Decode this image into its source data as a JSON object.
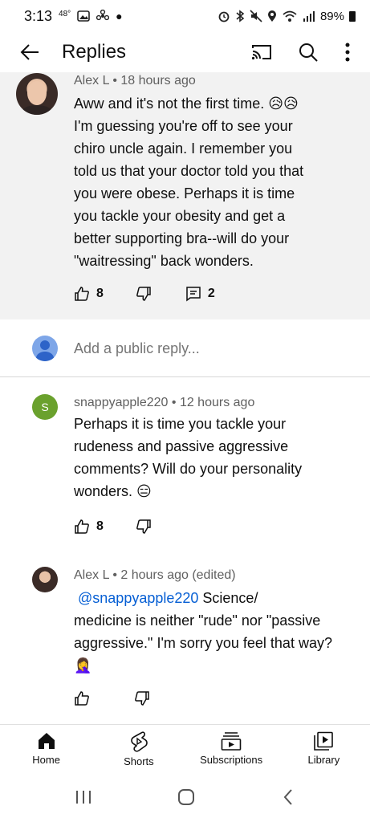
{
  "status_bar": {
    "time": "3:13",
    "temp": "48°",
    "battery": "89%"
  },
  "header": {
    "title": "Replies"
  },
  "parent_comment": {
    "author": "Alex L",
    "time": "18 hours ago",
    "text_lines": [
      "Aww and it's not the first time. 😥😥",
      "I'm guessing you're off to see your",
      "chiro uncle again.  I remember you",
      "told us that your doctor told you that",
      "you were obese. Perhaps it is time",
      "you tackle your obesity and get a",
      "better supporting bra--will do your",
      "\"waitressing\" back wonders."
    ],
    "likes": "8",
    "replies": "2"
  },
  "reply_input": {
    "placeholder": "Add a public reply..."
  },
  "replies": [
    {
      "avatar_letter": "S",
      "author": "snappyapple220",
      "time": "12 hours ago",
      "text_lines": [
        "Perhaps it is time you tackle your",
        "rudeness and passive aggressive",
        "comments? Will do your personality",
        "wonders. 😑"
      ],
      "likes": "8"
    },
    {
      "author": "Alex L",
      "time": "2 hours ago (edited)",
      "mention": "@snappyapple220",
      "text_first": " Science/",
      "text_lines": [
        "medicine is neither \"rude\" nor \"passive",
        "aggressive.\" I'm sorry you feel that way?",
        "🤦‍♀️"
      ]
    }
  ],
  "bottom_nav": {
    "home": "Home",
    "shorts": "Shorts",
    "subscriptions": "Subscriptions",
    "library": "Library"
  },
  "colors": {
    "highlight_bg": "#f2f2f2",
    "mention": "#065fd4",
    "avatar_s": "#6aa12d"
  }
}
